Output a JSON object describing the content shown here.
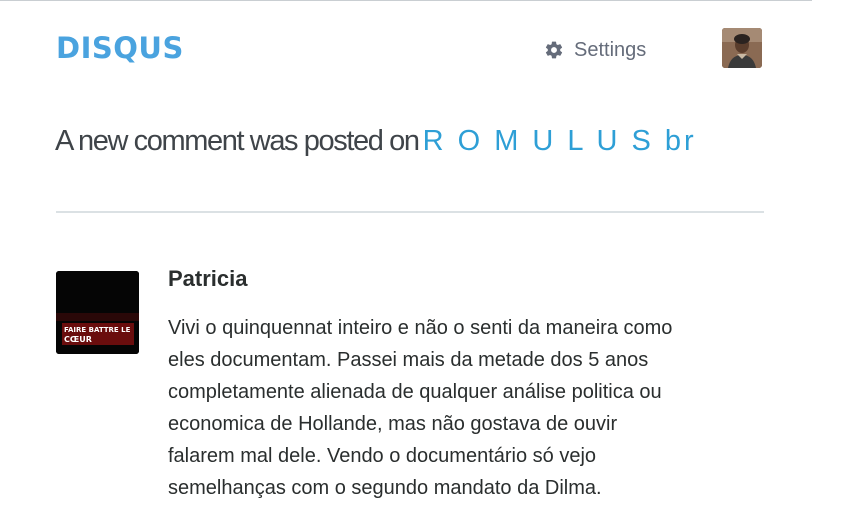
{
  "header": {
    "logo_text": "DISQUS",
    "settings_label": "Settings",
    "settings_icon": "gear-icon",
    "brand_color": "#4aa3df"
  },
  "notification": {
    "intro": "A new comment was posted on",
    "site_name": "R O M U L U S br",
    "link_color": "#2e9fd6"
  },
  "comment": {
    "author": "Patricia",
    "avatar_caption_line1": "FAIRE BATTRE LE",
    "avatar_caption_line2": "CŒUR",
    "lines": [
      "Vivi o quinquennat inteiro e não o senti da maneira como",
      "eles documentam. Passei mais da metade dos 5 anos",
      "completamente alienada de qualquer análise politica ou",
      "economica de Hollande, mas não gostava de ouvir",
      "falarem mal dele. Vendo o documentário só vejo",
      "semelhanças com o segundo mandato da Dilma."
    ]
  }
}
